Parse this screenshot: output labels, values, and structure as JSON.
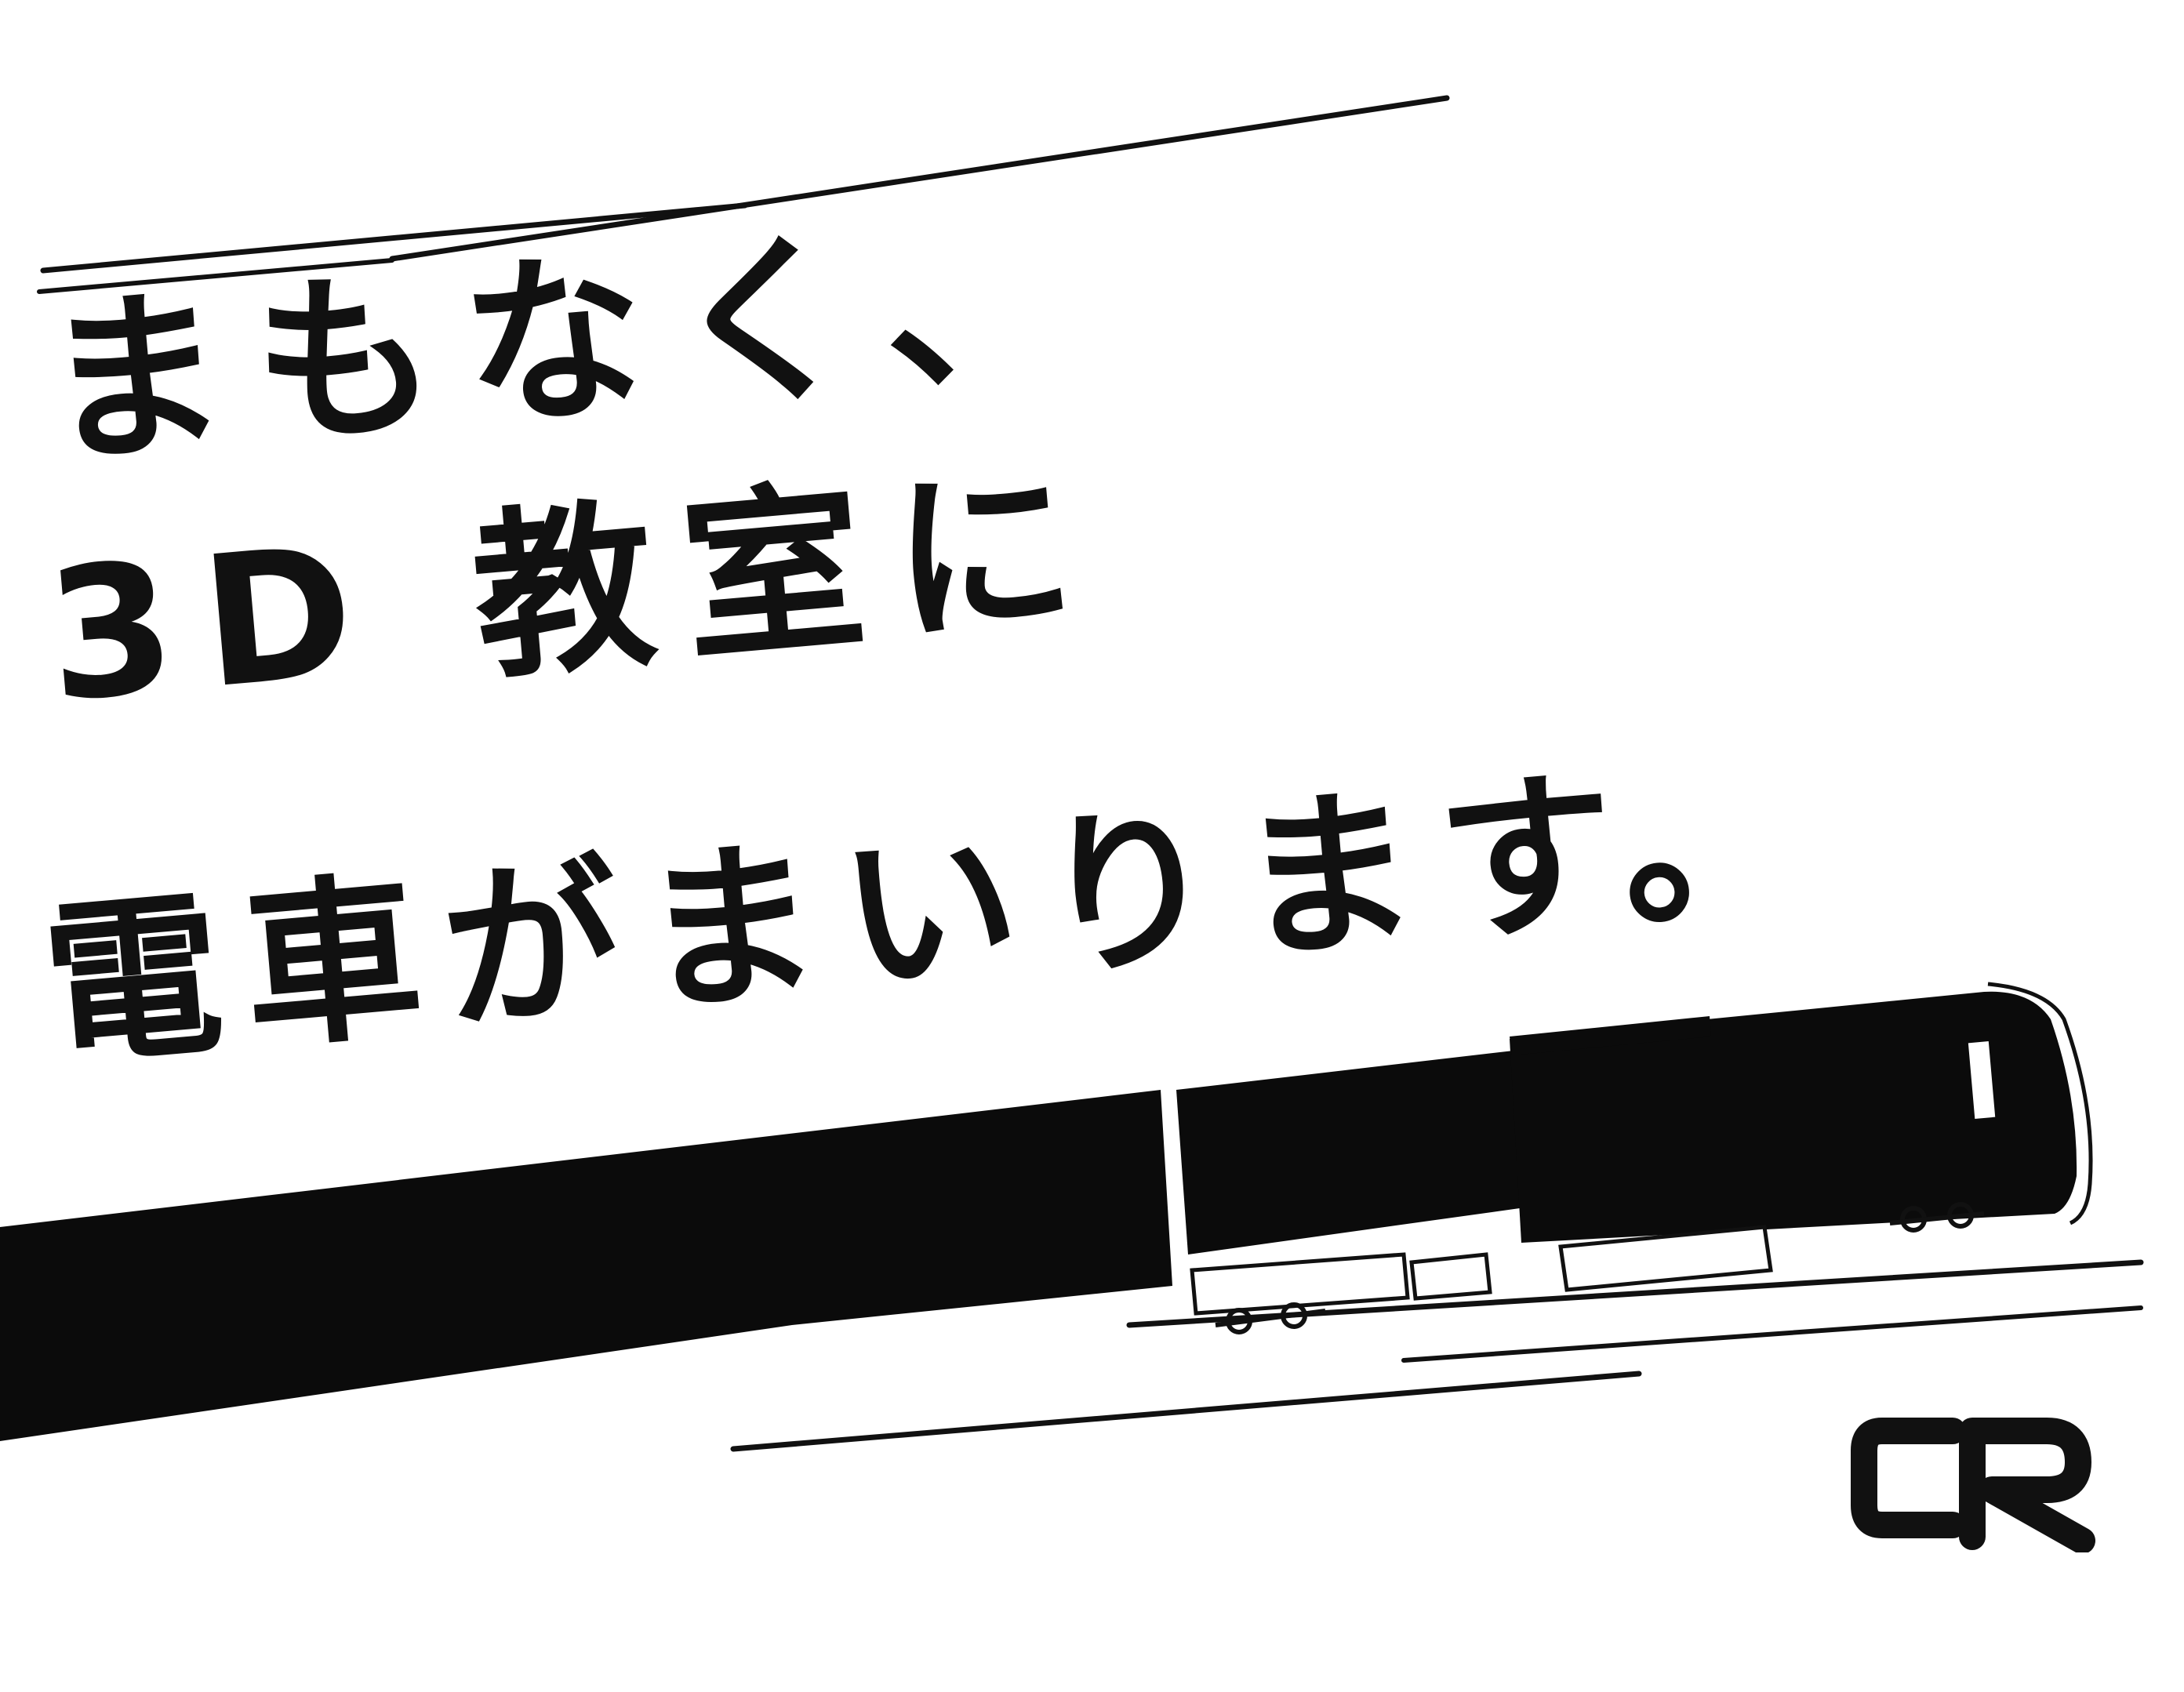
{
  "headline": {
    "line1": "まもなく、",
    "line2": "3D 教室に",
    "line3": "電車がまいります。"
  },
  "logo": {
    "text": "CR"
  },
  "colors": {
    "ink": "#111111",
    "paper": "#ffffff"
  }
}
